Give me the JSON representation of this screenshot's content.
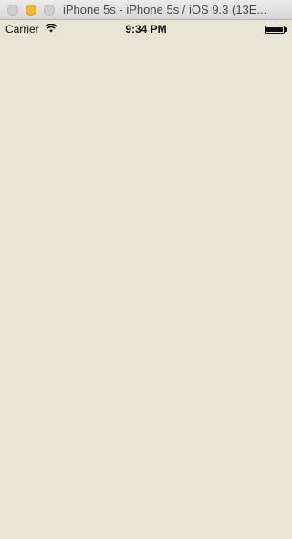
{
  "window": {
    "title": "iPhone 5s - iPhone 5s / iOS 9.3 (13E..."
  },
  "status_bar": {
    "carrier": "Carrier",
    "time": "9:34 PM",
    "battery_level": 1.0
  },
  "icons": {
    "close": "close-icon",
    "minimize": "minimize-icon",
    "zoom": "zoom-icon",
    "wifi": "wifi-icon",
    "battery": "battery-icon"
  },
  "colors": {
    "background": "#e8e4d6",
    "minimize": "#f5b82e"
  }
}
